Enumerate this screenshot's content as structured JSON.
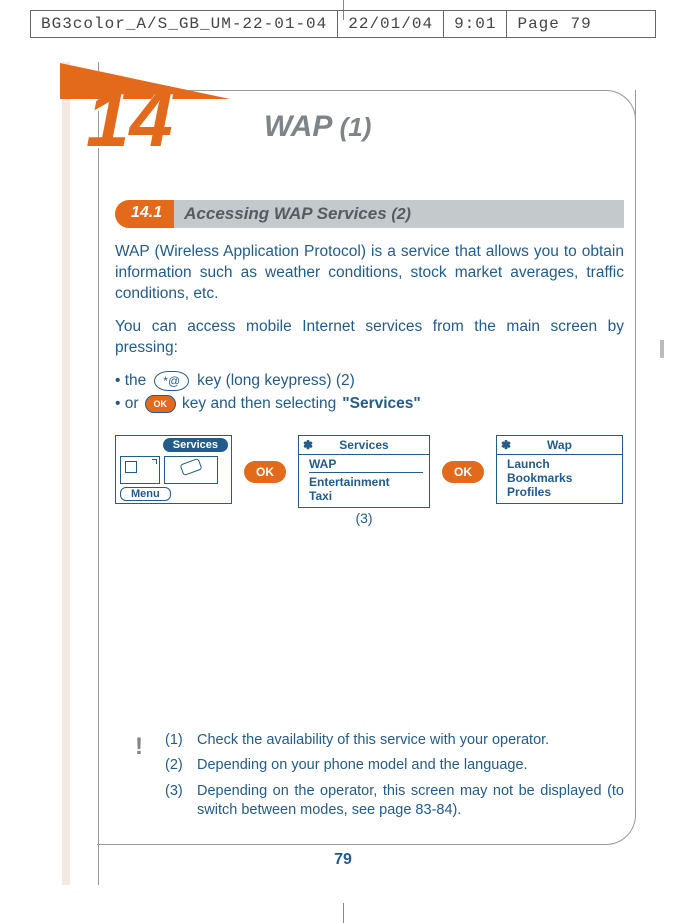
{
  "crop": {
    "file": "BG3color_A/S_GB_UM-22-01-04",
    "date": "22/01/04",
    "time": "9:01",
    "page": "Page 79"
  },
  "chapter": {
    "number": "14",
    "title": "WAP",
    "title_suffix": "(1)"
  },
  "section": {
    "number": "14.1",
    "title": "Accessing WAP Services",
    "title_suffix": "(2)"
  },
  "body": {
    "para1": "WAP (Wireless Application Protocol) is a service that allows you to obtain information such as weather conditions, stock market averages, traffic conditions, etc.",
    "para2": "You can access mobile Internet services from the main screen by pressing:",
    "bullet1_pre": "• the",
    "bullet1_key": "*@",
    "bullet1_post": "key (long keypress) (2)",
    "bullet2_pre": "• or",
    "bullet2_ok": "OK",
    "bullet2_post_a": "key and then selecting",
    "bullet2_post_b": "\"Services\""
  },
  "screens": {
    "s1": {
      "title": "Services",
      "menu": "Menu"
    },
    "ok": "OK",
    "s2": {
      "icon": "✽",
      "title": "Services",
      "item1": "WAP",
      "item2": "Entertainment",
      "item3": "Taxi",
      "caption": "(3)"
    },
    "s3": {
      "icon": "✽",
      "title": "Wap",
      "item1": "Launch",
      "item2": "Bookmarks",
      "item3": "Profiles"
    }
  },
  "notes": {
    "bang": "!",
    "n1_num": "(1)",
    "n1": "Check the availability of this service with your operator.",
    "n2_num": "(2)",
    "n2": "Depending on your phone model and the language.",
    "n3_num": "(3)",
    "n3": "Depending on the operator, this screen may not be displayed (to switch between modes, see page 83-84)."
  },
  "page_number": "79"
}
